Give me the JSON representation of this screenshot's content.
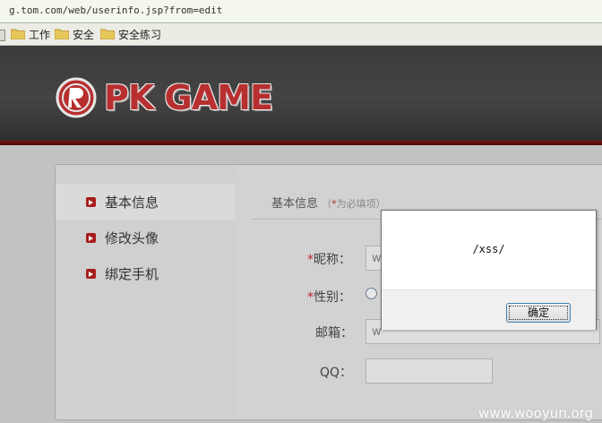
{
  "browser": {
    "url": "g.tom.com/web/userinfo.jsp?from=edit",
    "bookmarks": [
      {
        "label": "工作",
        "icon": "folder-icon"
      },
      {
        "label": "安全",
        "icon": "folder-icon"
      },
      {
        "label": "安全练习",
        "icon": "folder-icon"
      }
    ]
  },
  "site": {
    "logo_text": "PK GAME",
    "logo_mark": "R"
  },
  "sidebar": {
    "items": [
      {
        "label": "基本信息",
        "active": true
      },
      {
        "label": "修改头像",
        "active": false
      },
      {
        "label": "绑定手机",
        "active": false
      }
    ]
  },
  "form": {
    "section_title": "基本信息",
    "section_hint_prefix": "（",
    "section_hint_req": "*",
    "section_hint_text": "为必填项）",
    "required_mark": "*",
    "nickname_label": "昵称：",
    "nickname_value": "w",
    "gender_label": "性别：",
    "email_label": "邮箱：",
    "email_value": "w",
    "qq_label": "QQ：",
    "qq_value": ""
  },
  "alert": {
    "message": "/xss/",
    "ok_label": "确定"
  },
  "watermark": "www.wooyun.org",
  "colors": {
    "brand_red": "#b72f2f",
    "header_dark": "#3c3c3c"
  }
}
